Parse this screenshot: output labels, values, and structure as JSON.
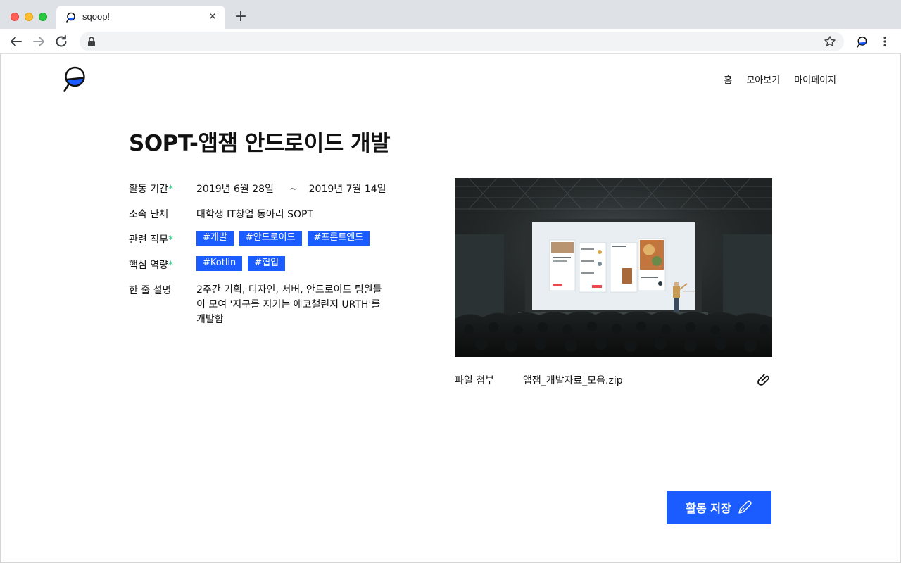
{
  "browser": {
    "tab_title": "sqoop!",
    "tab_close": "✕",
    "new_tab": "+"
  },
  "nav": {
    "items": [
      "홈",
      "모아보기",
      "마이페이지"
    ]
  },
  "page": {
    "title": "SOPT-앱잼 안드로이드 개발"
  },
  "info": {
    "period": {
      "label": "활동 기간",
      "required": "*",
      "start": "2019년 6월 28일",
      "separator": "~",
      "end": "2019년 7월 14일"
    },
    "organization": {
      "label": "소속 단체",
      "value": "대학생 IT창업 동아리 SOPT"
    },
    "jobs": {
      "label": "관련 직무",
      "required": "*",
      "tags": [
        "#개발",
        "#안드로이드",
        "#프론트엔드"
      ]
    },
    "skills": {
      "label": "핵심 역량",
      "required": "*",
      "tags": [
        "#Kotlin",
        "#협업"
      ]
    },
    "description": {
      "label": "한 줄 설명",
      "value": "2주간 기획, 디자인, 서버, 안드로이드 팀원들이 모여 '지구를 지키는 에코챌린지 URTH'를 개발함"
    }
  },
  "attachment": {
    "label": "파일 첨부",
    "filename": "앱잼_개발자료_모음.zip"
  },
  "actions": {
    "save_label": "활동 저장"
  },
  "colors": {
    "accent": "#1a5cff",
    "required": "#2fd48a"
  },
  "icons": {
    "logo": "magnifier-logo-icon",
    "attach": "paperclip-icon",
    "save": "pen-nib-icon"
  }
}
